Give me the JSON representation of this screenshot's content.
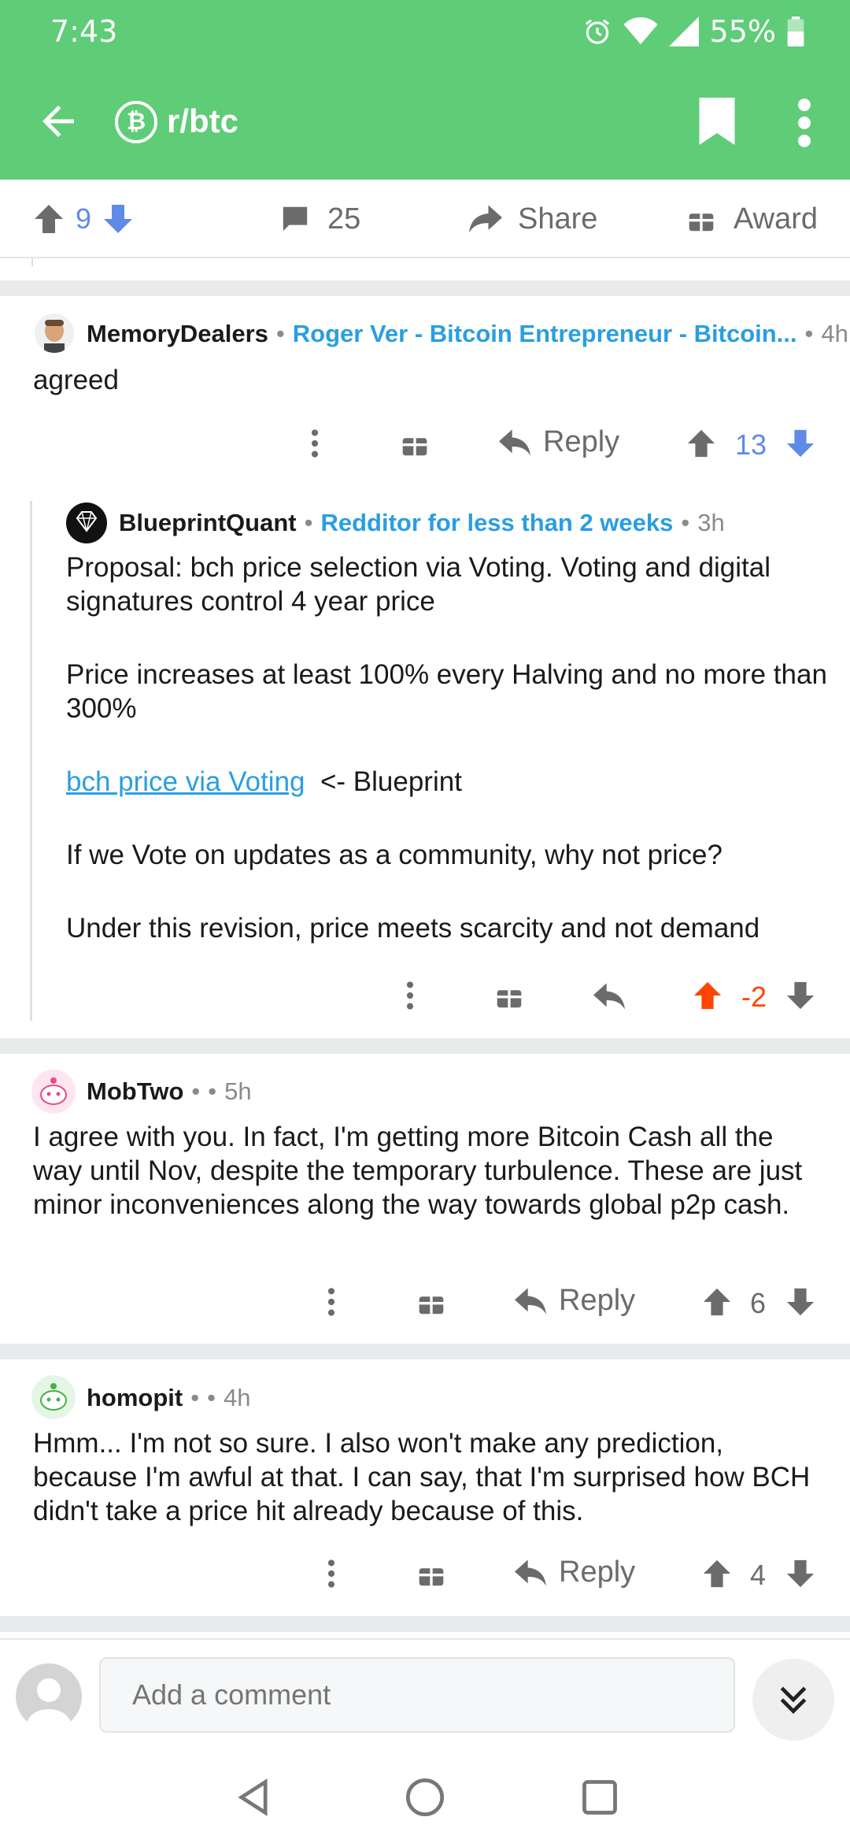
{
  "status": {
    "time": "7:43",
    "battery": "55%"
  },
  "header": {
    "subreddit": "r/btc",
    "sub_icon": "₿",
    "bg_color": "#5fcc77"
  },
  "post_actions": {
    "score": "9",
    "comments": "25",
    "share": "Share",
    "award": "Award"
  },
  "comments": [
    {
      "author": "MemoryDealers",
      "flair": "Roger Ver - Bitcoin Entrepreneur - Bitcoin...",
      "time": "4h",
      "body": "agreed",
      "reply": "Reply",
      "score": "13"
    },
    {
      "author": "BlueprintQuant",
      "flair": "Redditor for less than 2 weeks",
      "time": "3h",
      "paragraphs": [
        "Proposal: bch price selection via Voting. Voting and digital signatures control 4 year price",
        "Price increases at least 100% every Halving and no more than 300%",
        "If we Vote on updates as a community, why not price?",
        "Under this revision, price meets scarcity and not demand"
      ],
      "link_text": "bch price via Voting",
      "link_suffix": "<- Blueprint",
      "score": "-2"
    },
    {
      "author": "MobTwo",
      "time": "5h",
      "body": "I agree with you. In fact, I'm getting more Bitcoin Cash all the way until Nov, despite the temporary turbulence. These are just minor inconveniences along the way towards global p2p cash.",
      "reply": "Reply",
      "score": "6"
    },
    {
      "author": "homopit",
      "time": "4h",
      "body": "Hmm... I'm not so sure. I also won't make any prediction, because I'm awful at that. I can say, that I'm surprised how BCH didn't take a price hit already because of this.",
      "reply": "Reply",
      "score": "4"
    }
  ],
  "composer": {
    "placeholder": "Add a comment"
  },
  "colors": {
    "upvote_active": "#ff4500",
    "downvote": "#5f8be8",
    "link": "#2a9ee0"
  }
}
